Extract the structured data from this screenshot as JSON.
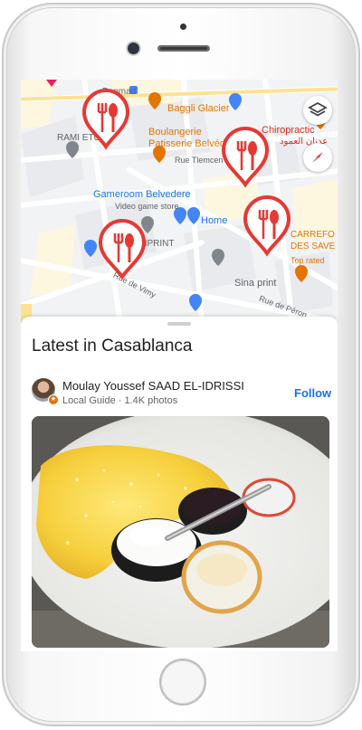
{
  "map": {
    "places": {
      "banmad": "Banmad",
      "baggli": "Baggli Glacier",
      "rami": "RAMI ETUDE",
      "boulangerie1": "Boulangerie",
      "boulangerie2": "Patisserie Belvédère",
      "chiropractic": "Chiropractic",
      "arabic": "عدنان العمود",
      "street_tlemcen": "Rue Tlemcen",
      "gameroom": "Gameroom Belvedere",
      "gameroom_sub": "Video game store",
      "home": "Home",
      "cnprint": "CNPRINT",
      "carrefour1": "CARREFO",
      "carrefour2": "DES SAVE",
      "top_rated": "Top rated",
      "street_vimy": "Rue de Vimy",
      "sina": "Sina print",
      "street_peron": "Rue de Péron"
    },
    "icons": [
      "layers-icon",
      "compass-icon",
      "restaurant-marker-icon"
    ],
    "colors": {
      "marker": "#e53935",
      "street": "#ffffff",
      "block": "#f1f3f4",
      "yellow_road": "#fde293",
      "poi_orange": "#e37400",
      "poi_blue": "#1a73e8"
    }
  },
  "feed": {
    "title": "Latest in Casablanca",
    "author": "Moulay Youssef SAAD EL-IDRISSI",
    "author_meta": "Local Guide · 1.4K photos",
    "follow_label": "Follow",
    "photo_alt": "Omelette with cheese, butter and jam on a plate"
  }
}
